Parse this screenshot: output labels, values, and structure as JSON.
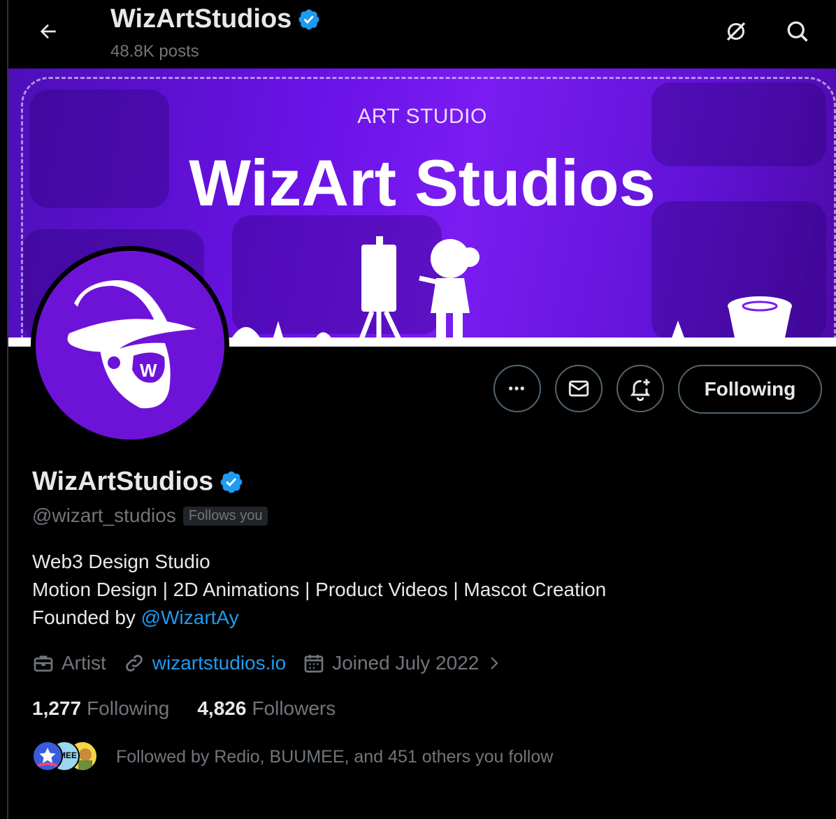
{
  "header": {
    "title": "WizArtStudios",
    "posts": "48.8K posts"
  },
  "banner": {
    "subtitle": "ART STUDIO",
    "title": "WizArt Studios"
  },
  "actions": {
    "more_glyph": "•••",
    "following_label": "Following"
  },
  "profile": {
    "name": "WizArtStudios",
    "handle": "@wizart_studios",
    "follows_you": "Follows you",
    "bio_line1": "Web3 Design Studio",
    "bio_line2": "Motion Design | 2D Animations | Product Videos | Mascot Creation",
    "bio_line3_prefix": "Founded by ",
    "bio_mention": "@WizartAy",
    "category": "Artist",
    "website": "wizartstudios.io",
    "joined": "Joined July 2022"
  },
  "stats": {
    "following_count": "1,277",
    "following_label": "Following",
    "followers_count": "4,826",
    "followers_label": "Followers"
  },
  "followed_by": {
    "text": "Followed by Redio, BUUMEE, and 451 others you follow",
    "mini_avatar_label": "MEE"
  },
  "colors": {
    "accent": "#1d9bf0",
    "banner_purple": "#6a12e6",
    "avatar_purple": "#6d13d8",
    "muted": "#71767b"
  },
  "icons": [
    "back-arrow-icon",
    "grok-icon",
    "search-icon",
    "more-icon",
    "mail-icon",
    "notification-add-icon",
    "verified-badge-icon",
    "briefcase-icon",
    "link-icon",
    "calendar-icon",
    "chevron-right-icon"
  ]
}
